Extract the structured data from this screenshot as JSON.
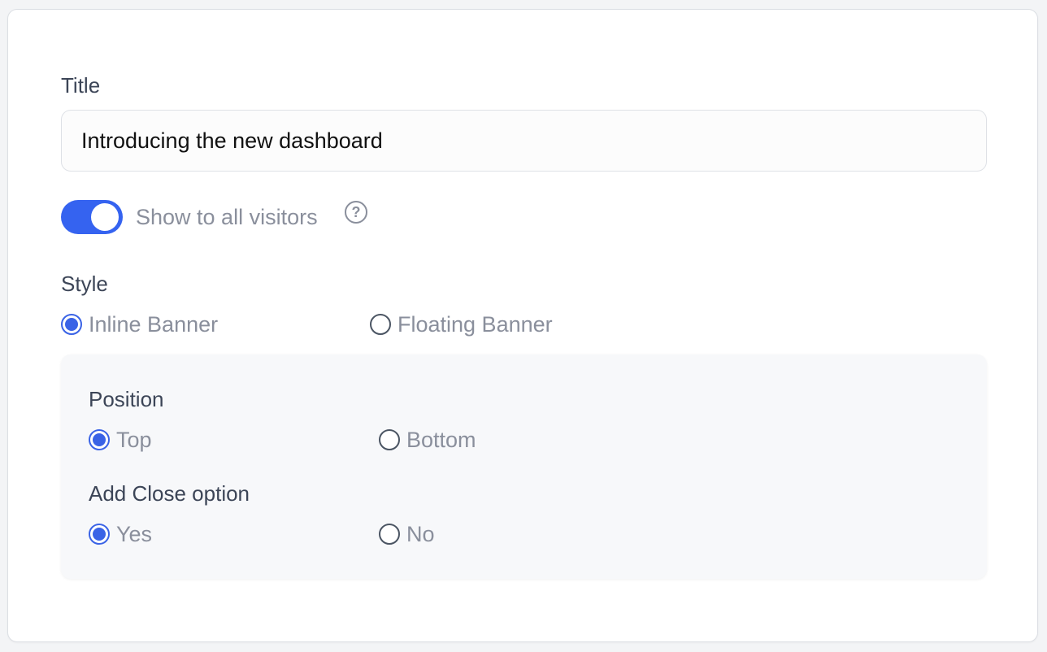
{
  "form": {
    "title_label": "Title",
    "title_value": "Introducing the new dashboard",
    "visibility_toggle": {
      "label": "Show to all visitors",
      "on": true,
      "help_icon": "question-circle-icon"
    },
    "style": {
      "label": "Style",
      "options": [
        {
          "label": "Inline Banner",
          "selected": true
        },
        {
          "label": "Floating Banner",
          "selected": false
        }
      ]
    },
    "position": {
      "label": "Position",
      "options": [
        {
          "label": "Top",
          "selected": true
        },
        {
          "label": "Bottom",
          "selected": false
        }
      ]
    },
    "close_option": {
      "label": "Add Close option",
      "options": [
        {
          "label": "Yes",
          "selected": true
        },
        {
          "label": "No",
          "selected": false
        }
      ]
    }
  },
  "colors": {
    "accent": "#3563f0",
    "muted_text": "#8a8f9c",
    "label_text": "#3c4557"
  }
}
